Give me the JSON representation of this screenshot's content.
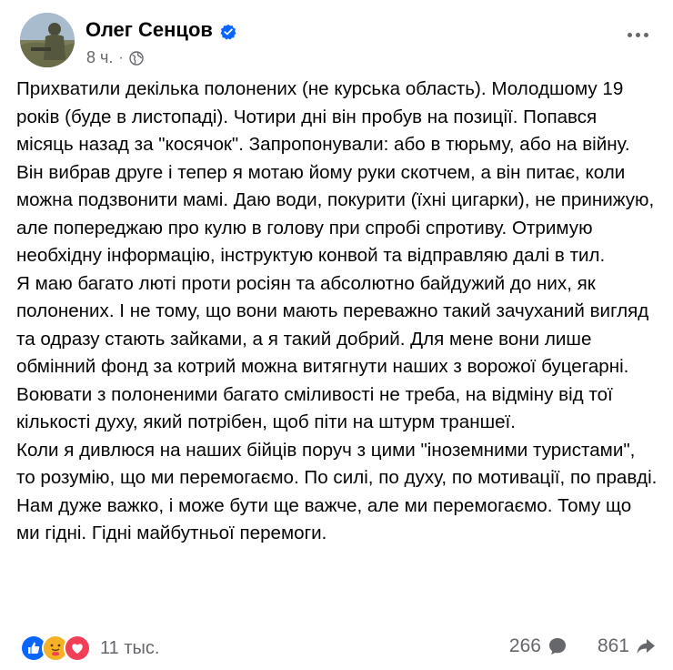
{
  "author": {
    "name": "Олег Сенцов",
    "timestamp": "8 ч."
  },
  "post": {
    "paragraphs": [
      "Прихватили декілька полонених (не курська область). Молодшому 19 років (буде в листопаді). Чотири дні він пробув на позиції. Попався місяць назад за \"косячок\". Запропонували: або в тюрьму, або на війну. Він вибрав друге і тепер я мотаю йому руки скотчем, а він питає, коли можна подзвонити мамі. Даю води, покурити (їхні цигарки), не принижую, але попереджаю про кулю в голову при спробі спротиву. Отримую необхідну інформацію, інструктую конвой та відправляю далі в тил.",
      "Я маю багато люті проти росіян та абсолютно байдужий до них, як полонених. І не тому, що вони мають переважно такий зачуханий вигляд та одразу стають зайками, а я такий добрий. Для мене вони лише обмінний фонд за котрий можна витягнути наших з ворожої буцегарні. Воювати з полоненими багато сміливості не треба, на відміну від тої кількості духу, який потрібен, щоб піти на штурм траншеї.",
      "Коли я дивлюся на наших бійців поруч з цими \"іноземними туристами\", то розумію, що ми перемогаємо. По силі, по духу, по мотивації, по правді. Нам дуже важко, і може бути ще важче, але ми перемогаємо. Тому що ми гідні. Гідні майбутньої перемоги."
    ]
  },
  "footer": {
    "reactions_count": "11 тыс.",
    "comments_count": "266",
    "shares_count": "861"
  },
  "colors": {
    "accent": "#0866ff",
    "muted": "#65676b",
    "text": "#050505"
  }
}
